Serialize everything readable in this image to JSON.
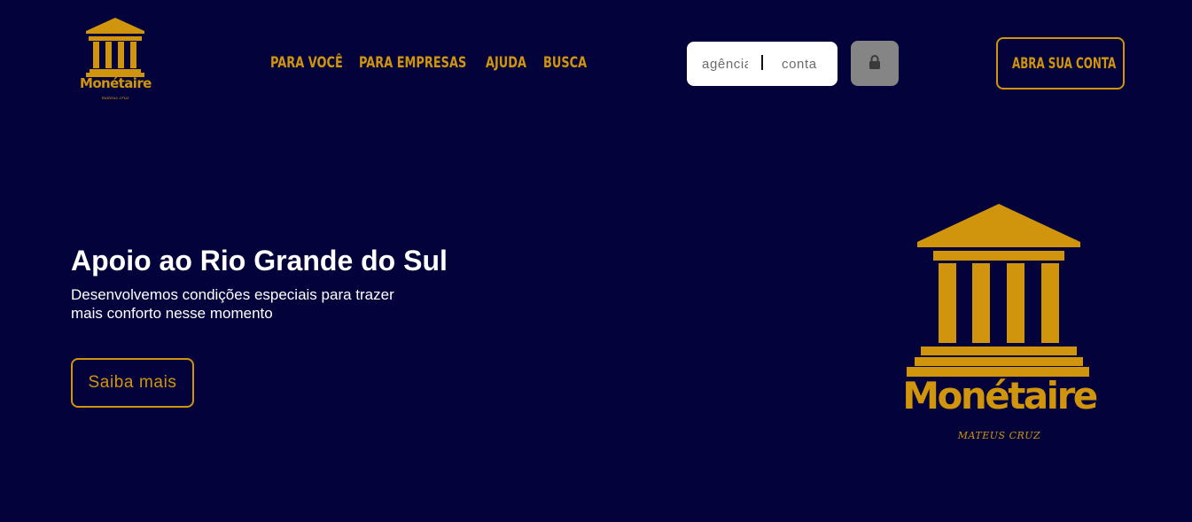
{
  "header": {
    "logo": {
      "brand": "Monétaire",
      "signature": "mateus cruz",
      "icon": "temple-icon"
    },
    "nav": [
      {
        "label": "PARA VOCÊ"
      },
      {
        "label": "PARA EMPRESAS"
      },
      {
        "label": "AJUDA"
      },
      {
        "label": "BUSCA"
      }
    ],
    "login": {
      "agencia_placeholder": "agência",
      "conta_placeholder": "conta",
      "submit_icon": "lock-icon"
    },
    "open_account_label": "ABRA SUA CONTA"
  },
  "hero": {
    "title": "Apoio ao Rio Grande do Sul",
    "subtitle": "Desenvolvemos condições especiais para trazer mais conforto nesse momento",
    "cta_label": "Saiba mais"
  },
  "hero_logo": {
    "brand": "Monétaire",
    "signature": "MATEUS CRUZ",
    "icon": "temple-icon"
  },
  "colors": {
    "background": "#03023a",
    "accent": "#d0950c",
    "lock_button": "#858585",
    "text": "#ffffff"
  }
}
